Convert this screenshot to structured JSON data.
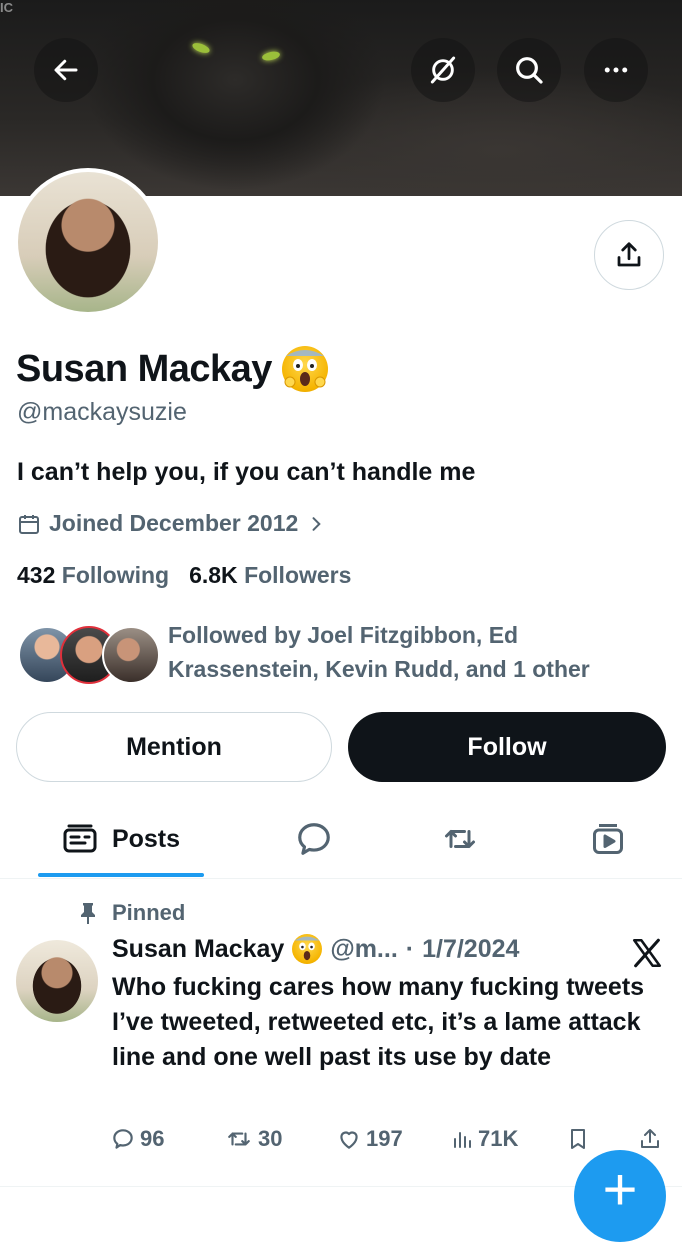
{
  "banner": {
    "corner_text": "IC"
  },
  "nav": {
    "back_icon": "arrow-left-icon",
    "translate_icon": "slashed-circle-icon",
    "search_icon": "search-icon",
    "more_icon": "more-dots-icon"
  },
  "profile": {
    "name": "Susan Mackay",
    "name_emoji": "😱",
    "handle": "@mackaysuzie",
    "bio": "I can’t help you, if you can’t handle me",
    "joined": "Joined December 2012",
    "following_count": "432",
    "following_label": "Following",
    "followers_count": "6.8K",
    "followers_label": "Followers",
    "followed_by": "Followed by Joel Fitzgibbon, Ed Krassenstein, Kevin Rudd, and 1 other"
  },
  "buttons": {
    "mention": "Mention",
    "follow": "Follow"
  },
  "tabs": [
    {
      "label": "Posts",
      "icon": "posts-icon",
      "active": true
    },
    {
      "label": "",
      "icon": "replies-bubble-icon",
      "active": false
    },
    {
      "label": "",
      "icon": "repost-icon",
      "active": false
    },
    {
      "label": "",
      "icon": "media-video-icon",
      "active": false
    }
  ],
  "pinned_tweet": {
    "pinned_label": "Pinned",
    "author_name": "Susan Mackay",
    "author_emoji": "😱",
    "handle_truncated": "@m...",
    "separator": "·",
    "date": "1/7/2024",
    "text": "Who fucking cares how many fucking tweets I’ve tweeted, retweeted etc, it’s a lame attack line and one well past its use by date",
    "replies": "96",
    "reposts": "30",
    "likes": "197",
    "views": "71K"
  },
  "fab_label": "+",
  "colors": {
    "accent": "#1d9bf0",
    "text": "#0f1419",
    "secondary": "#536471",
    "border": "#cfd9de"
  }
}
